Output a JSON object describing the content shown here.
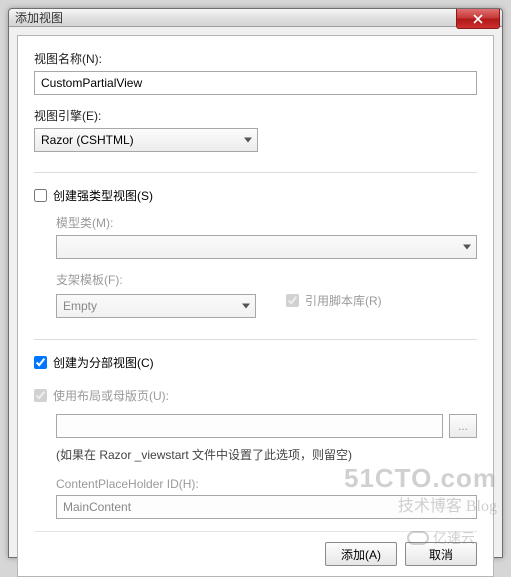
{
  "window": {
    "title": "添加视图"
  },
  "fields": {
    "viewName": {
      "label": "视图名称(N):",
      "value": "CustomPartialView"
    },
    "viewEngine": {
      "label": "视图引擎(E):",
      "value": "Razor (CSHTML)"
    },
    "stronglyTyped": {
      "label": "创建强类型视图(S)"
    },
    "modelClass": {
      "label": "模型类(M):",
      "value": ""
    },
    "scaffold": {
      "label": "支架模板(F):",
      "value": "Empty"
    },
    "referenceScript": {
      "label": "引用脚本库(R)"
    },
    "partialView": {
      "label": "创建为分部视图(C)"
    },
    "useLayout": {
      "label": "使用布局或母版页(U):"
    },
    "layoutPath": {
      "value": ""
    },
    "layoutHint": "(如果在 Razor _viewstart 文件中设置了此选项，则留空)",
    "contentPlaceholder": {
      "label": "ContentPlaceHolder ID(H):",
      "value": "MainContent"
    },
    "browse": "..."
  },
  "buttons": {
    "add": "添加(A)",
    "cancel": "取消"
  },
  "watermarks": {
    "w1": "51CTO.com",
    "w2": "技术博客  Blog",
    "w3": "亿速云"
  }
}
